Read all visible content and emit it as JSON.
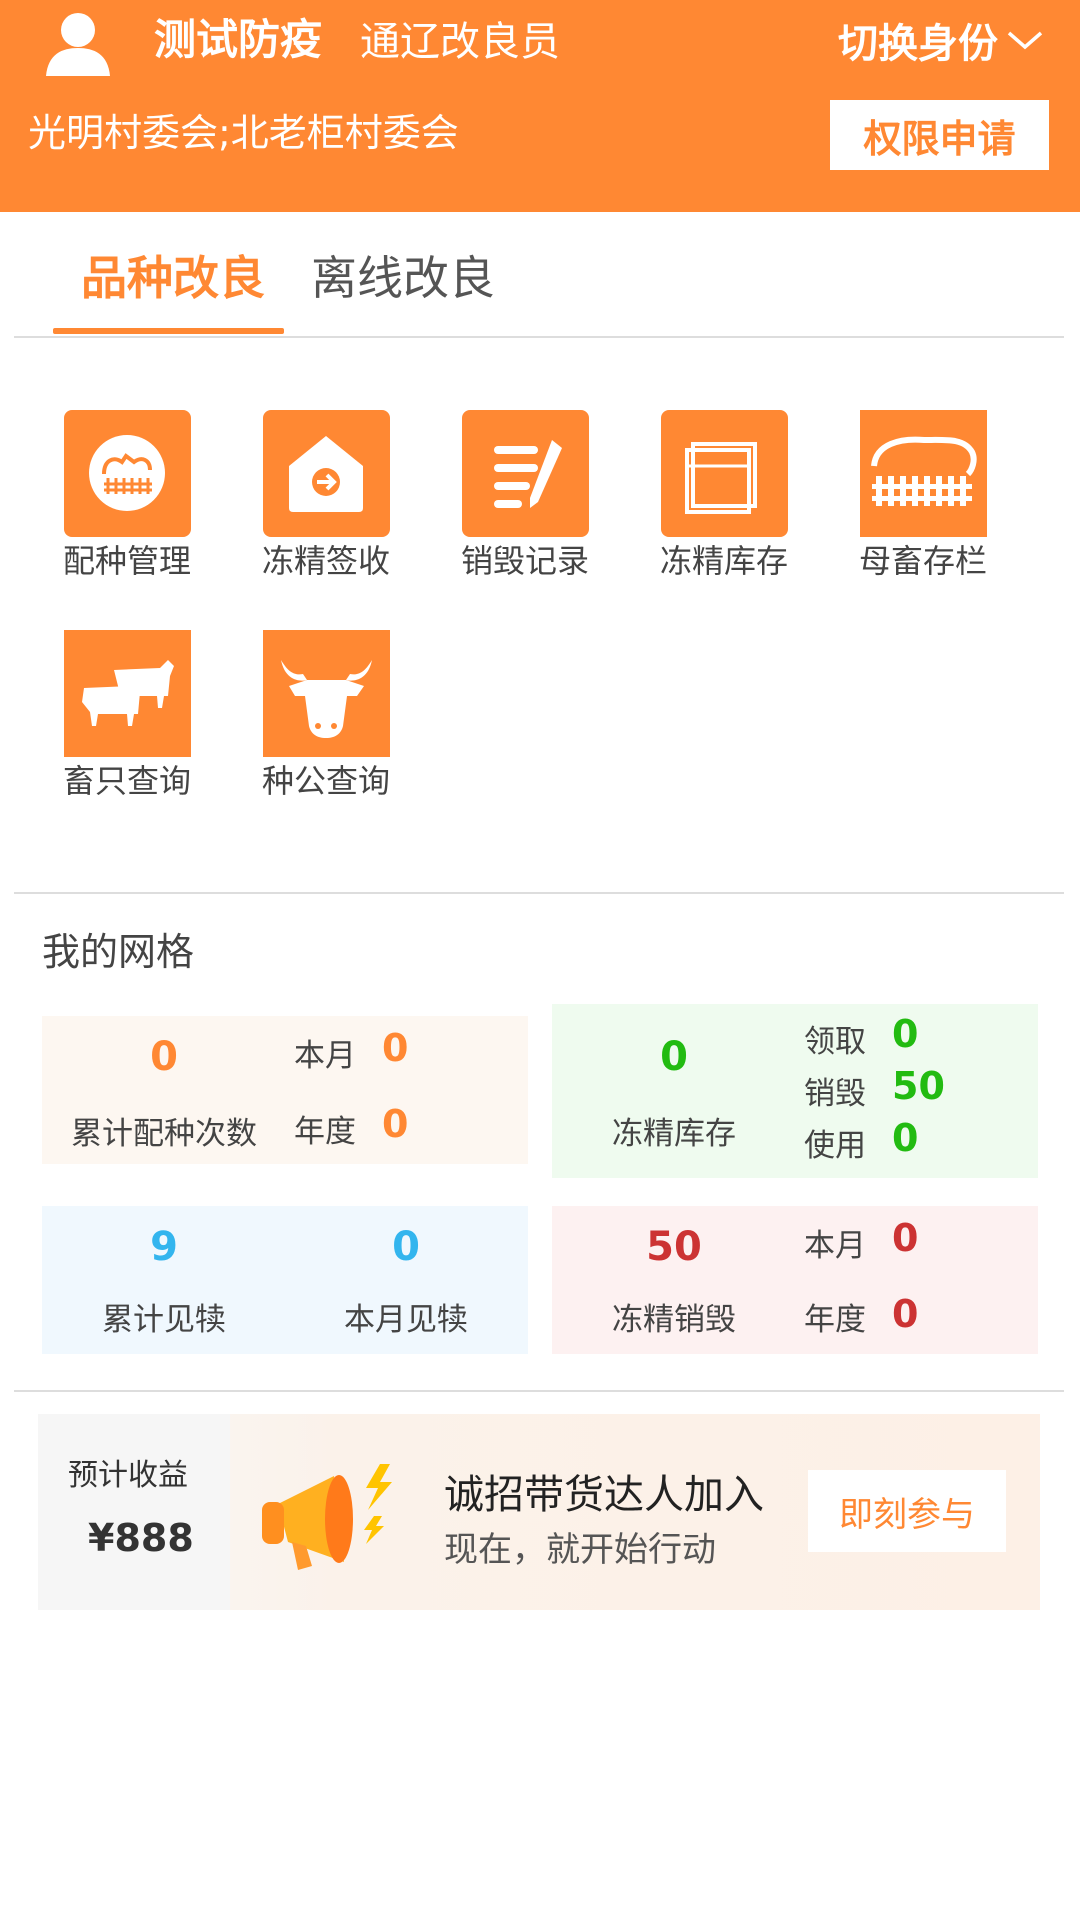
{
  "header": {
    "user_name": "测试防疫",
    "role": "通辽改良员",
    "switch_label": "切换身份",
    "organization": "光明村委会;北老柜村委会",
    "permission_button": "权限申请"
  },
  "tabs": [
    {
      "label": "品种改良",
      "active": true
    },
    {
      "label": "离线改良",
      "active": false
    }
  ],
  "menu": [
    {
      "label": "配种管理",
      "icon": "breeding-icon"
    },
    {
      "label": "冻精签收",
      "icon": "receive-icon"
    },
    {
      "label": "销毁记录",
      "icon": "edit-record-icon"
    },
    {
      "label": "冻精库存",
      "icon": "inventory-box-icon"
    },
    {
      "label": "母畜存栏",
      "icon": "pen-fence-icon"
    },
    {
      "label": "畜只查询",
      "icon": "cattle-icon"
    },
    {
      "label": "种公查询",
      "icon": "bull-head-icon"
    }
  ],
  "grid": {
    "title": "我的网格",
    "breeding": {
      "total": "0",
      "total_label": "累计配种次数",
      "month_label": "本月",
      "month": "0",
      "year_label": "年度",
      "year": "0"
    },
    "semen_stock": {
      "total": "0",
      "total_label": "冻精库存",
      "receive_label": "领取",
      "receive": "0",
      "destroy_label": "销毁",
      "destroy": "50",
      "use_label": "使用",
      "use": "0"
    },
    "calving": {
      "total": "9",
      "total_label": "累计见犊",
      "month": "0",
      "month_label": "本月见犊"
    },
    "semen_destroy": {
      "total": "50",
      "total_label": "冻精销毁",
      "month_label": "本月",
      "month": "0",
      "year_label": "年度",
      "year": "0"
    }
  },
  "promo": {
    "earnings_label": "预计收益",
    "earnings": "¥888",
    "title": "诚招带货达人加入",
    "subtitle": "现在，就开始行动",
    "button": "即刻参与"
  },
  "colors": {
    "accent": "#ff8833",
    "green": "#22bb11",
    "blue": "#33b5ee",
    "red": "#cc3333"
  }
}
